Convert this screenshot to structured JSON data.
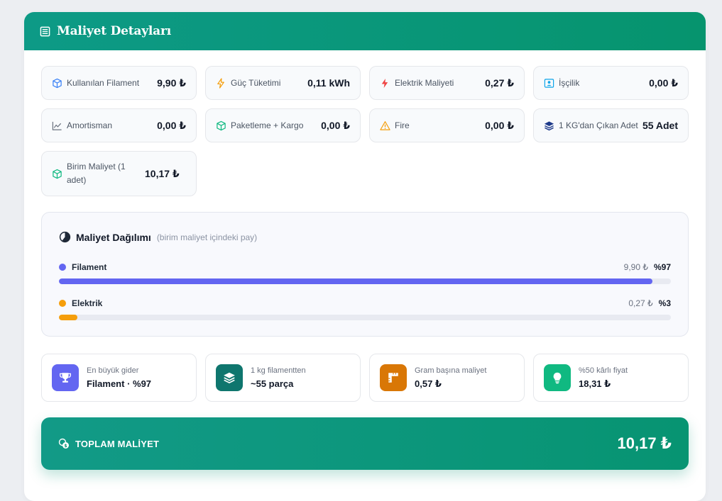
{
  "header": {
    "title": "Maliyet Detayları",
    "icon": "list-icon"
  },
  "stats": [
    {
      "label": "Kullanılan Filament",
      "value": "9,90 ₺",
      "icon": "cube-icon",
      "color": "#3b82f6"
    },
    {
      "label": "Güç Tüketimi",
      "value": "0,11 kWh",
      "icon": "bolt-icon",
      "color": "#f59e0b"
    },
    {
      "label": "Elektrik Maliyeti",
      "value": "0,27 ₺",
      "icon": "lightning-icon",
      "color": "#ef4444"
    },
    {
      "label": "İşçilik",
      "value": "0,00 ₺",
      "icon": "worker-icon",
      "color": "#0ea5e9"
    },
    {
      "label": "Amortisman",
      "value": "0,00 ₺",
      "icon": "chart-line-icon",
      "color": "#6b7280"
    },
    {
      "label": "Paketleme + Kargo",
      "value": "0,00 ₺",
      "icon": "box-icon",
      "color": "#10b981"
    },
    {
      "label": "Fire",
      "value": "0,00 ₺",
      "icon": "warning-icon",
      "color": "#f59e0b"
    },
    {
      "label": "1 KG'dan Çıkan Adet",
      "value": "55 Adet",
      "icon": "layers-icon",
      "color": "#1e3a8a"
    },
    {
      "label": "Birim Maliyet (1 adet)",
      "value": "10,17 ₺",
      "icon": "box-icon",
      "color": "#10b981"
    }
  ],
  "distribution": {
    "title": "Maliyet Dağılımı",
    "subtitle": "(birim maliyet içindeki pay)",
    "items": [
      {
        "name": "Filament",
        "amount": "9,90 ₺",
        "percent_label": "%97",
        "percent": 97,
        "color": "#6366f1"
      },
      {
        "name": "Elektrik",
        "amount": "0,27 ₺",
        "percent_label": "%3",
        "percent": 3,
        "color": "#f59e0b"
      }
    ]
  },
  "mini_cards": [
    {
      "label": "En büyük gider",
      "value": "Filament · %97",
      "icon": "trophy-icon",
      "bg": "#6366f1"
    },
    {
      "label": "1 kg filamentten",
      "value": "~55 parça",
      "icon": "layers-icon",
      "bg": "#0f766e"
    },
    {
      "label": "Gram başına maliyet",
      "value": "0,57 ₺",
      "icon": "ruler-icon",
      "bg": "#d97706"
    },
    {
      "label": "%50 kârlı fiyat",
      "value": "18,31 ₺",
      "icon": "lightbulb-icon",
      "bg": "#10b981"
    }
  ],
  "total": {
    "label": "TOPLAM MALİYET",
    "value": "10,17 ₺",
    "icon": "coins-icon"
  }
}
